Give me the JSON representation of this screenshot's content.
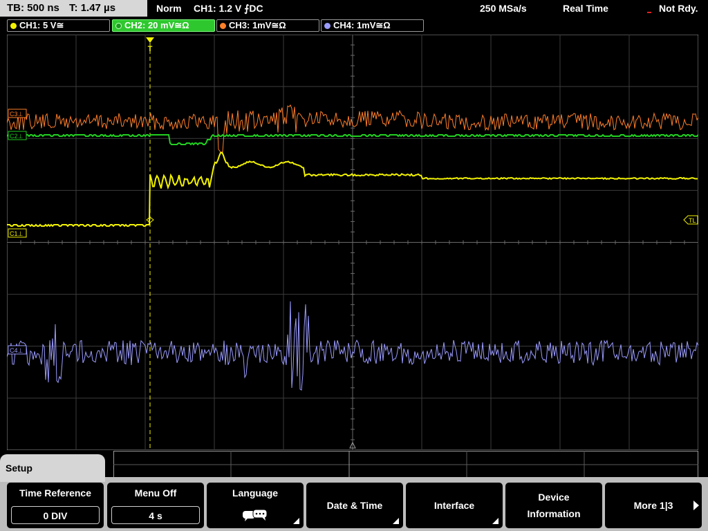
{
  "status": {
    "timebase_label": "TB: 500 ns",
    "trigger_time_label": "T: 1.47 µs",
    "trigger_mode": "Norm",
    "trigger_setting": "CH1: 1.2 V ⨍DC",
    "sample_rate": "250 MSa/s",
    "acquisition_mode": "Real Time",
    "readiness": "Not Rdy."
  },
  "channels": [
    {
      "label": "CH1: 5 V≅",
      "color": "#f2f200"
    },
    {
      "label": "CH2: 20 mV≅Ω",
      "color": "#22d022"
    },
    {
      "label": "CH3: 1mV≅Ω",
      "color": "#ff7f2a"
    },
    {
      "label": "CH4: 1mV≅Ω",
      "color": "#9b9bff"
    }
  ],
  "markers": {
    "ch3": "C3⊥",
    "ch2": "C2⊥",
    "ch4": "C4⊥",
    "ch1": "C1⊥",
    "trigger_level": "TL",
    "trigger_position": "T"
  },
  "menu": {
    "title": "Setup",
    "softkeys": {
      "time_reference": {
        "label": "Time Reference",
        "value": "0 DIV"
      },
      "menu_off": {
        "label": "Menu Off",
        "value": "4 s"
      },
      "language": {
        "label": "Language"
      },
      "date_time": {
        "label": "Date & Time"
      },
      "interface": {
        "label": "Interface"
      },
      "device_information": {
        "label_line1": "Device",
        "label_line2": "Information"
      },
      "more": {
        "label": "More 1|3"
      }
    }
  }
}
